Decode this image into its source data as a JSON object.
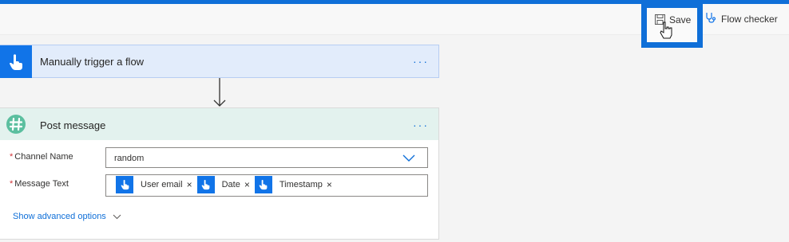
{
  "toolbar": {
    "save_label": "Save",
    "flow_checker_label": "Flow checker"
  },
  "trigger_card": {
    "title": "Manually trigger a flow",
    "more": "···"
  },
  "post_card": {
    "title": "Post message",
    "more": "···",
    "channel": {
      "required": "*",
      "label": "Channel Name",
      "value": "random"
    },
    "message": {
      "required": "*",
      "label": "Message Text",
      "tokens": [
        {
          "label": "User email",
          "remove": "×"
        },
        {
          "label": "Date",
          "remove": "×"
        },
        {
          "label": "Timestamp",
          "remove": "×"
        }
      ]
    },
    "advanced_label": "Show advanced options"
  },
  "colors": {
    "accent": "#0f6fd8",
    "trigger_bg": "#e2ecfb",
    "slack_header_bg": "#e3f2ee",
    "slack_green": "#5bbf9f",
    "required": "#d13438"
  },
  "icons": {
    "save": "floppy-disk-icon",
    "checker": "stethoscope-icon",
    "trigger": "hand-pointer-icon",
    "post": "slack-hash-icon",
    "dropdown": "chevron-down-icon"
  }
}
